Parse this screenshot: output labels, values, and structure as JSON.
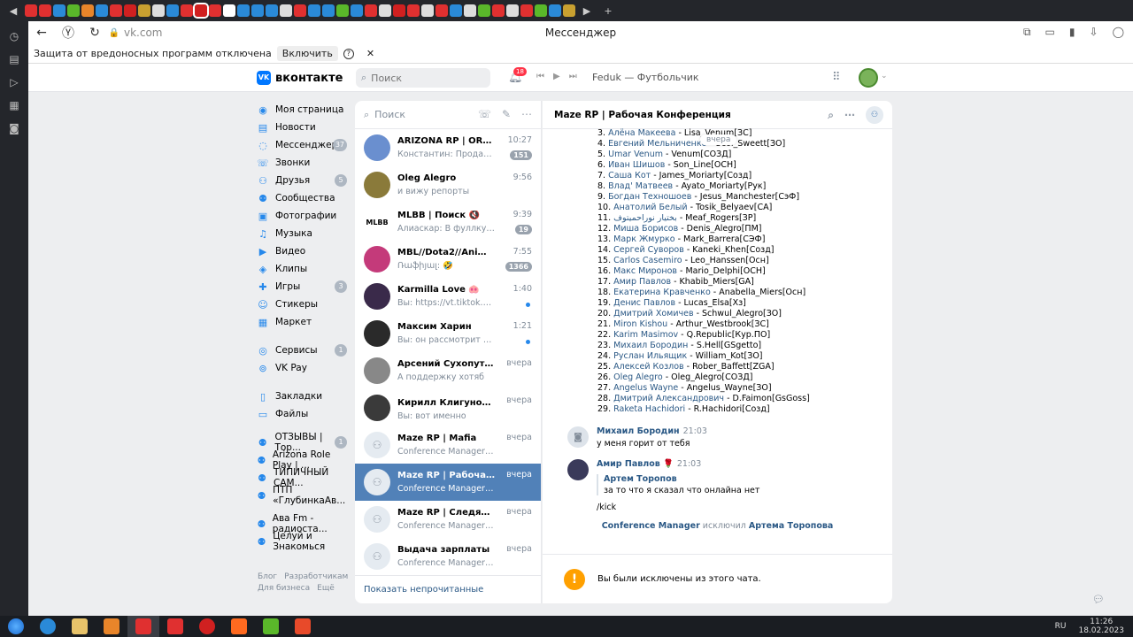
{
  "browser": {
    "url": "vk.com",
    "page_title": "Мессенджер",
    "infobar_text": "Защита от вредоносных программ отключена",
    "infobar_button": "Включить"
  },
  "header": {
    "logo": "вконтакте",
    "search_placeholder": "Поиск",
    "notifications": "18",
    "track": "Feduk — Футбольчик"
  },
  "sidebar": {
    "items": [
      {
        "label": "Моя страница",
        "icon": "user-icon"
      },
      {
        "label": "Новости",
        "icon": "news-icon"
      },
      {
        "label": "Мессенджер",
        "icon": "message-icon",
        "count": "37"
      },
      {
        "label": "Звонки",
        "icon": "phone-icon"
      },
      {
        "label": "Друзья",
        "icon": "friends-icon",
        "count": "5"
      },
      {
        "label": "Сообщества",
        "icon": "groups-icon"
      },
      {
        "label": "Фотографии",
        "icon": "photo-icon"
      },
      {
        "label": "Музыка",
        "icon": "music-icon"
      },
      {
        "label": "Видео",
        "icon": "video-icon"
      },
      {
        "label": "Клипы",
        "icon": "clips-icon"
      },
      {
        "label": "Игры",
        "icon": "games-icon",
        "count": "3"
      },
      {
        "label": "Стикеры",
        "icon": "sticker-icon"
      },
      {
        "label": "Маркет",
        "icon": "market-icon"
      }
    ],
    "items2": [
      {
        "label": "Сервисы",
        "icon": "services-icon",
        "count": "1"
      },
      {
        "label": "VK Pay",
        "icon": "pay-icon"
      }
    ],
    "items3": [
      {
        "label": "Закладки",
        "icon": "bookmark-icon"
      },
      {
        "label": "Файлы",
        "icon": "file-icon"
      }
    ],
    "items4": [
      {
        "label": "ОТЗЫВЫ | Тор...",
        "icon": "groups-icon",
        "count": "1"
      },
      {
        "label": "Arizona Role Play | ...",
        "icon": "groups-icon"
      },
      {
        "label": "ТИПИЧНЫЙ САМ...",
        "icon": "groups-icon"
      },
      {
        "label": "ПТП «ГлубинкаАв...",
        "icon": "groups-icon"
      }
    ],
    "items5": [
      {
        "label": "Ава Fm - радиоста...",
        "icon": "groups-icon"
      },
      {
        "label": "Целуй и Знакомься",
        "icon": "groups-icon"
      }
    ],
    "footer": [
      "Блог",
      "Разработчикам",
      "Для бизнеса",
      "Ещё"
    ]
  },
  "chatlist": {
    "search_placeholder": "Поиск",
    "chats": [
      {
        "name": "ARIZONA RP | ORION | ИГ...",
        "preview": "Константин: Продам мес...",
        "time": "10:27",
        "unread": "151",
        "color": "#6a8fcf"
      },
      {
        "name": "Oleg Alegro",
        "preview": "и вижу репорты",
        "time": "9:56",
        "color": "#8a7a3a"
      },
      {
        "name": "MLBB | Поиск 🔇",
        "preview": "Алиаскар: В фуллку нуже...",
        "time": "9:39",
        "unread": "19",
        "color": "#ffffff"
      },
      {
        "name": "MBL//Dota2//Anime//✰",
        "preview": "Ռաֆիյալ: 🤣",
        "time": "7:55",
        "unread": "1366",
        "color": "#c43a7a"
      },
      {
        "name": "Karmilla Love 🐽",
        "preview": "Вы: https://vt.tiktok.com/ZS8atfhvb/",
        "time": "1:40",
        "dot": true,
        "color": "#3a2a4a"
      },
      {
        "name": "Максим Харин",
        "preview": "Вы: он рассмотрит лично",
        "time": "1:21",
        "dot": true,
        "color": "#2a2a2a"
      },
      {
        "name": "Арсений Сухопутный 👍",
        "preview": "А поддержку хотяб",
        "time": "вчера",
        "color": "#888888"
      },
      {
        "name": "Кирилл Клигунов 🅱",
        "preview": "Вы: вот именно",
        "time": "вчера",
        "color": "#3a3a3a"
      },
      {
        "name": "Maze RP | Mafia",
        "preview": "Conference Manager исключил Артем...",
        "time": "вчера",
        "color": "#e5ebf1"
      },
      {
        "name": "Maze RP | Рабочая Конфе...",
        "preview": "Conference Manager исключил Артем...",
        "time": "вчера",
        "color": "#e5ebf1",
        "active": true
      },
      {
        "name": "Maze RP | Следящие",
        "preview": "Conference Manager исключил Артем...",
        "time": "вчера",
        "color": "#e5ebf1"
      },
      {
        "name": "Выдача зарплаты",
        "preview": "Conference Manager исключил Артем...",
        "time": "вчера",
        "color": "#e5ebf1"
      }
    ],
    "footer": "Показать непрочитанные"
  },
  "conversation": {
    "title": "Maze RP | Рабочая Конференция",
    "date_pill": "вчера",
    "members": [
      {
        "n": "3.",
        "name": "Алёна Макеева",
        "rest": " - Lisa_Venum[ЗС]"
      },
      {
        "n": "4.",
        "name": "Евгений Мельниченко",
        "rest": " - Ucol_Sweett[ЗО]"
      },
      {
        "n": "5.",
        "name": "Umar Venum",
        "rest": " - Venum[СОЗД]"
      },
      {
        "n": "6.",
        "name": "Иван Шишов",
        "rest": " - Son_Line[ОСН]"
      },
      {
        "n": "7.",
        "name": "Саша Кот",
        "rest": " - James_Moriarty[Созд]"
      },
      {
        "n": "8.",
        "name": "Влад' Матвеев",
        "rest": " - Ayato_Moriarty[Рук]"
      },
      {
        "n": "9.",
        "name": "Богдан Техношоев",
        "rest": " - Jesus_Manchester[СэФ]"
      },
      {
        "n": "10.",
        "name": "Анатолий Белый",
        "rest": " - Tosik_Belyaev[СА]"
      },
      {
        "n": "11.",
        "name": "بختیار نوراحمیتوف",
        "rest": " - Meaf_Rogers[ЗР]"
      },
      {
        "n": "12.",
        "name": "Миша Борисов",
        "rest": " - Denis_Alegro[ПМ]"
      },
      {
        "n": "13.",
        "name": "Марк Жмурко",
        "rest": " - Mark_Barrera[СЭФ]"
      },
      {
        "n": "14.",
        "name": "Сергей Суворов",
        "rest": " - Kaneki_Khen[Созд]"
      },
      {
        "n": "15.",
        "name": "Carlos Casemiro",
        "rest": " - Leo_Hanssen[Осн]"
      },
      {
        "n": "16.",
        "name": "Макс Миронов",
        "rest": " - Mario_Delphi[ОСН]"
      },
      {
        "n": "17.",
        "name": "Амир Павлов",
        "rest": " - Khabib_Miers[GA]"
      },
      {
        "n": "18.",
        "name": "Екатерина Кравченко",
        "rest": " - Anabella_Miers[Осн]"
      },
      {
        "n": "19.",
        "name": "Денис Павлов",
        "rest": " - Lucas_Elsa[Хз]"
      },
      {
        "n": "20.",
        "name": "Дмитрий Хомичев",
        "rest": " - Schwul_Alegro[ЗО]"
      },
      {
        "n": "21.",
        "name": "Miron Kishou",
        "rest": " - Arthur_Westbrook[ЗС]"
      },
      {
        "n": "22.",
        "name": "Karim Masimov",
        "rest": " - Q.Republic[Кур.ПО]"
      },
      {
        "n": "23.",
        "name": "Михаил Бородин",
        "rest": " - S.Hell[GSgetto]"
      },
      {
        "n": "24.",
        "name": "Руслан Ильящик",
        "rest": " - William_Kot[ЗО]"
      },
      {
        "n": "25.",
        "name": "Алексей Козлов",
        "rest": " - Rober_Baffett[ZGA]"
      },
      {
        "n": "26.",
        "name": "Oleg Alegro",
        "rest": " - Oleg_Alegro[СОЗД]"
      },
      {
        "n": "27.",
        "name": "Angelus Wayne",
        "rest": " - Angelus_Wayne[ЗО]"
      },
      {
        "n": "28.",
        "name": "Дмитрий Александрович",
        "rest": " - D.Faimon[GsGoss]"
      },
      {
        "n": "29.",
        "name": "Raketa Hachidori",
        "rest": " - R.Hachidori[Созд]"
      }
    ],
    "msg1": {
      "author": "Михаил Бородин",
      "time": "21:03",
      "text": "у меня горит от тебя"
    },
    "msg2": {
      "author": "Амир Павлов 🌹",
      "time": "21:03",
      "reply_author": "Артем Торопов",
      "reply_text": "за то что я сказал что онлайна нет",
      "text": "/kick"
    },
    "system": {
      "actor": "Conference Manager",
      "verb": " исключил ",
      "target": "Артема Торопова"
    },
    "kicked_notice": "Вы были исключены из этого чата."
  },
  "taskbar": {
    "lang": "RU",
    "time": "11:26",
    "date": "18.02.2023"
  }
}
